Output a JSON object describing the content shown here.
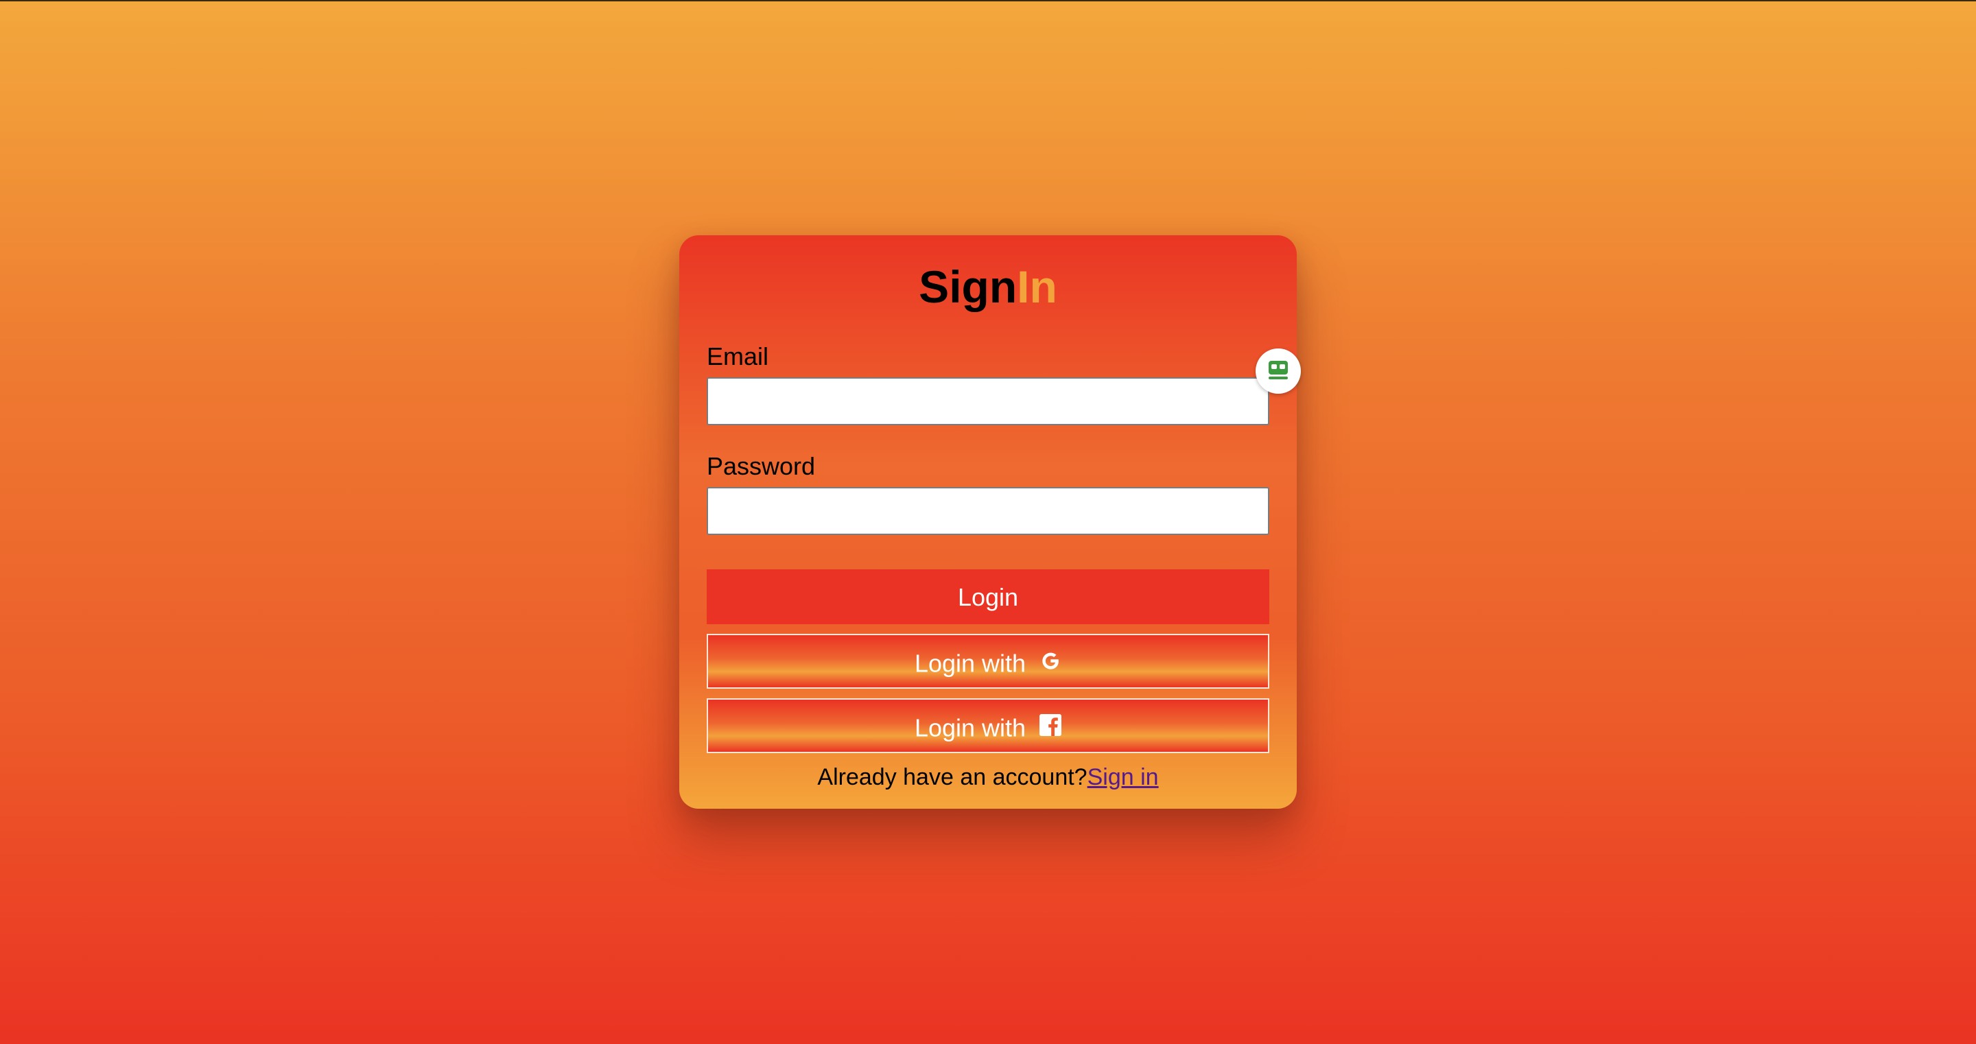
{
  "form": {
    "title_part1": "Sign",
    "title_part2": "In",
    "email_label": "Email",
    "email_value": "",
    "password_label": "Password",
    "password_value": "",
    "login_button": "Login",
    "google_button": "Login with",
    "facebook_button": "Login with",
    "footer_text": "Already have an account?",
    "footer_link": "Sign in"
  },
  "icons": {
    "google": "google-icon",
    "facebook": "facebook-icon",
    "helper": "password-manager-icon"
  },
  "colors": {
    "primary_red": "#ea3324",
    "accent_orange": "#f3a33c",
    "link_purple": "#551a8b"
  }
}
